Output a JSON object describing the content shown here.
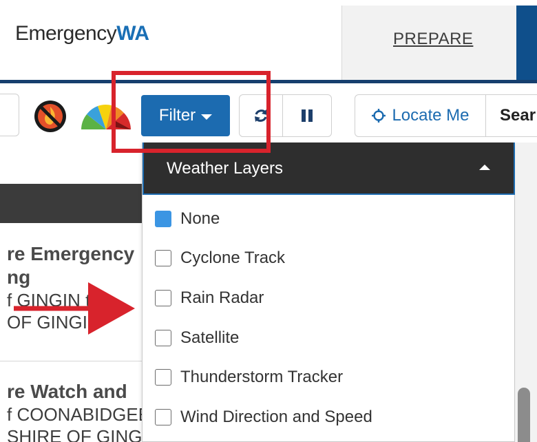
{
  "header": {
    "logo_part1": "Emergency",
    "logo_part2": "WA",
    "prepare_tab": "PREPARE",
    "colors": {
      "logo_accent": "#1a6fb5",
      "header_rule": "#163f6e"
    }
  },
  "toolbar": {
    "fire_ban_icon": "fire-ban-icon",
    "danger_icon": "fire-danger-rating-gauge-icon",
    "filter_label": "Filter",
    "refresh_icon": "refresh-icon",
    "pause_icon": "pause-icon",
    "locate_label": "Locate Me",
    "search_label": "Sear",
    "colors": {
      "primary": "#1c6bb0"
    }
  },
  "incidents": [
    {
      "title_line1": "re Emergency",
      "title_line2": "ng",
      "detail_line1_prefix": "f ",
      "detail_line1_link": "GINGIN",
      "detail_line1_suffix": " the",
      "detail_line2": "OF GINGIN"
    },
    {
      "title_line1": "re Watch and",
      "detail_line1": "f COONABIDGEE",
      "detail_line2": "SHIRE OF GINGIN"
    }
  ],
  "dropdown": {
    "title": "Weather Layers",
    "options": [
      {
        "label": "None",
        "checked": true
      },
      {
        "label": "Cyclone Track",
        "checked": false
      },
      {
        "label": "Rain Radar",
        "checked": false
      },
      {
        "label": "Satellite",
        "checked": false
      },
      {
        "label": "Thunderstorm Tracker",
        "checked": false
      },
      {
        "label": "Wind Direction and Speed",
        "checked": false
      }
    ],
    "colors": {
      "checked": "#3b95e3",
      "header_bg": "#2e2e2e"
    }
  },
  "annotations": {
    "highlight_color": "#d8232c"
  }
}
